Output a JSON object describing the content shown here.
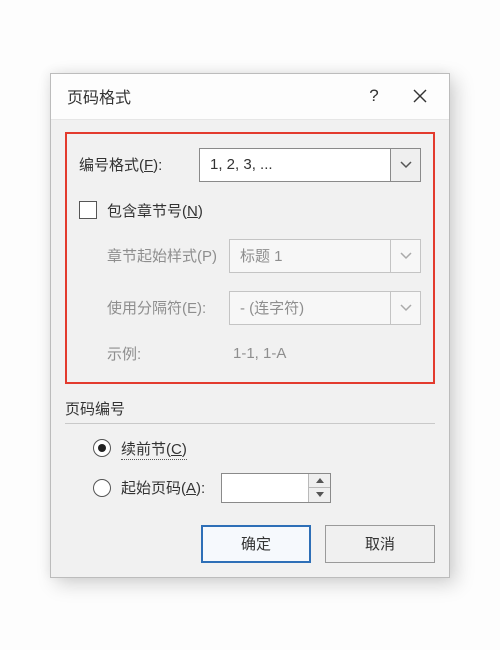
{
  "title": "页码格式",
  "numberFormat": {
    "label_pre": "编号格式(",
    "label_key": "F",
    "label_post": "):",
    "value": "1, 2, 3, ..."
  },
  "includeChapter": {
    "label_pre": "包含章节号(",
    "label_key": "N",
    "label_post": ")",
    "checked": false
  },
  "chapterStart": {
    "label": "章节起始样式(P)",
    "value": "标题 1"
  },
  "separator": {
    "label": "使用分隔符(E):",
    "value": "-  (连字符)"
  },
  "example": {
    "label": "示例:",
    "value": "1-1, 1-A"
  },
  "pageNumbering": {
    "title": "页码编号",
    "continue": {
      "label_pre": "续前节(",
      "label_key": "C",
      "label_post": ")",
      "checked": true
    },
    "startAt": {
      "label_pre": "起始页码(",
      "label_key": "A",
      "label_post": "):",
      "checked": false,
      "value": ""
    }
  },
  "buttons": {
    "ok": "确定",
    "cancel": "取消"
  }
}
